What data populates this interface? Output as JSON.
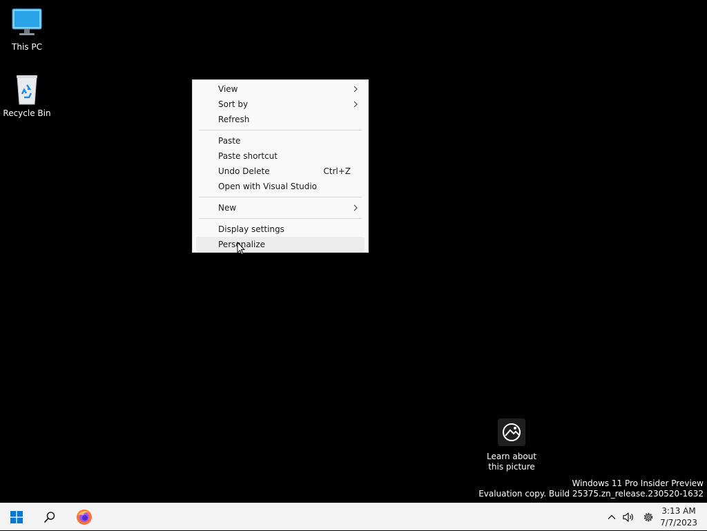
{
  "desktop": {
    "icons": [
      {
        "label": "This PC",
        "icon": "monitor-icon"
      },
      {
        "label": "Recycle Bin",
        "icon": "recycle-bin-icon"
      }
    ]
  },
  "context_menu": {
    "items": {
      "view": {
        "label": "View",
        "submenu": true
      },
      "sort_by": {
        "label": "Sort by",
        "submenu": true
      },
      "refresh": {
        "label": "Refresh"
      },
      "paste": {
        "label": "Paste"
      },
      "paste_shortcut": {
        "label": "Paste shortcut"
      },
      "undo_delete": {
        "label": "Undo Delete",
        "shortcut": "Ctrl+Z"
      },
      "open_with_vs": {
        "label": "Open with Visual Studio"
      },
      "new": {
        "label": "New",
        "submenu": true
      },
      "display_settings": {
        "label": "Display settings"
      },
      "personalize": {
        "label": "Personalize",
        "highlighted": true
      }
    }
  },
  "learn_picture": {
    "line1": "Learn about",
    "line2": "this picture",
    "icon": "image-circle-icon"
  },
  "watermark": {
    "line1": "Windows 11 Pro Insider Preview",
    "line2": "Evaluation copy. Build 25375.zn_release.230520-1632"
  },
  "taskbar": {
    "start_icon": "windows-logo-icon",
    "search_icon": "search-icon",
    "pinned_app_icon": "firefox-icon",
    "tray": {
      "chevron_icon": "chevron-up-icon",
      "volume_icon": "speaker-icon",
      "settings_icon": "gear-icon"
    },
    "clock": {
      "time": "3:13 AM",
      "date": "7/7/2023"
    }
  },
  "colors": {
    "desktop_bg": "#000000",
    "menu_bg": "#f9f9f9",
    "menu_hover": "#ececec",
    "taskbar_bg": "#f3f3f3",
    "windows_blue": "#0078d4"
  }
}
